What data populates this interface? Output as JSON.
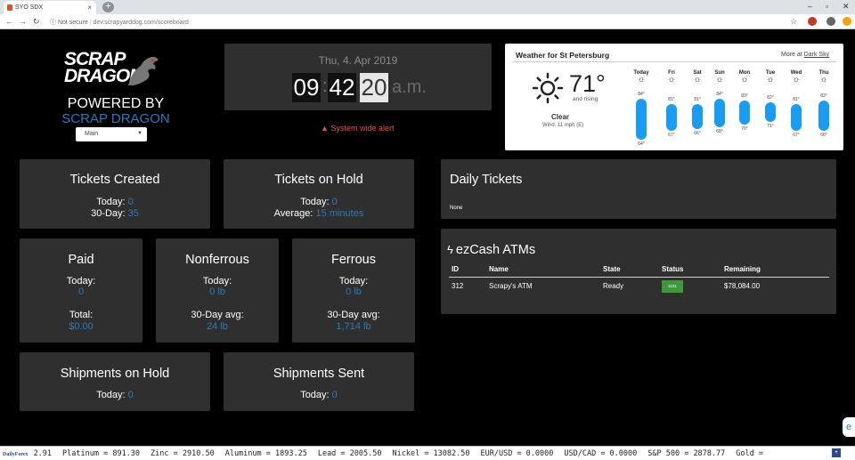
{
  "browser": {
    "tab_title": "SYO SDX",
    "security": "Not secure",
    "url": "dev.scrapyarddog.com/scoreboard"
  },
  "brand": {
    "logo_line1": "SCRAP",
    "logo_line2": "DRAGON",
    "powered_by": "POWERED BY",
    "powered_name": "SCRAP DRAGON",
    "location_select": "Main"
  },
  "clock": {
    "date": "Thu, 4. Apr 2019",
    "hour": "09",
    "minute": "42",
    "second": "20",
    "ampm": "a.m.",
    "alert": "System wide alert"
  },
  "weather": {
    "title": "Weather for St Petersburg",
    "more_prefix": "More at",
    "more_link": "Dark Sky",
    "temp": "71°",
    "trend": "and rising",
    "condition": "Clear",
    "wind": "Wind: 11 mph (E)",
    "days": [
      {
        "name": "Today",
        "hi": "84°",
        "lo": "64°"
      },
      {
        "name": "Fri",
        "hi": "81°",
        "lo": "67°"
      },
      {
        "name": "Sat",
        "hi": "81°",
        "lo": "66°"
      },
      {
        "name": "Sun",
        "hi": "84°",
        "lo": "68°"
      },
      {
        "name": "Mon",
        "hi": "83°",
        "lo": "70°"
      },
      {
        "name": "Tue",
        "hi": "82°",
        "lo": "71°"
      },
      {
        "name": "Wed",
        "hi": "81°",
        "lo": "67°"
      },
      {
        "name": "Thu",
        "hi": "83°",
        "lo": "66°"
      }
    ]
  },
  "tickets_created": {
    "title": "Tickets Created",
    "today_label": "Today:",
    "today_value": "0",
    "d30_label": "30-Day:",
    "d30_value": "35"
  },
  "tickets_hold": {
    "title": "Tickets on Hold",
    "today_label": "Today:",
    "today_value": "0",
    "avg_label": "Average:",
    "avg_value": "15 minutes"
  },
  "paid": {
    "title": "Paid",
    "today_label": "Today:",
    "today_value": "0",
    "total_label": "Total:",
    "total_value": "$0.00"
  },
  "nonferrous": {
    "title": "Nonferrous",
    "today_label": "Today:",
    "today_value": "0 lb",
    "avg_label": "30-Day avg:",
    "avg_value": "24 lb"
  },
  "ferrous": {
    "title": "Ferrous",
    "today_label": "Today:",
    "today_value": "0 lb",
    "avg_label": "30-Day avg:",
    "avg_value": "1,714 lb"
  },
  "shipments_hold": {
    "title": "Shipments on Hold",
    "today_label": "Today:",
    "today_value": "0"
  },
  "shipments_sent": {
    "title": "Shipments Sent",
    "today_label": "Today:",
    "today_value": "0"
  },
  "daily_tickets": {
    "title": "Daily Tickets",
    "content": "None"
  },
  "ezcash": {
    "title": "ezCash ATMs",
    "headers": [
      "ID",
      "Name",
      "State",
      "Status",
      "Remaining"
    ],
    "rows": [
      {
        "id": "312",
        "name": "Scrapy's ATM",
        "state": "Ready",
        "status": "1101",
        "remaining": "$78,084.00"
      }
    ]
  },
  "ticker": {
    "brand": "DailyForex",
    "items": [
      "2.91",
      "Platinum = 891.30",
      "Zinc = 2910.50",
      "Aluminum = 1893.25",
      "Lead = 2005.50",
      "Nickel = 13082.50",
      "EUR/USD = 0.0000",
      "USD/CAD = 0.0000",
      "S&P 500 = 2878.77",
      "Gold ="
    ]
  }
}
